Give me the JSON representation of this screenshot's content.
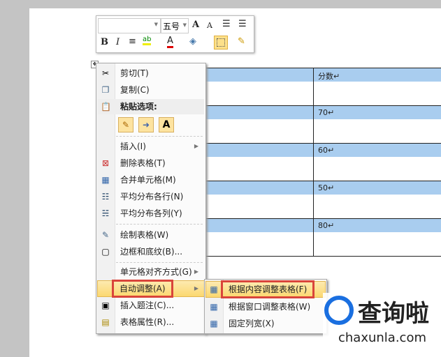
{
  "table": {
    "header": "分数↵",
    "values": [
      "70↵",
      "60↵",
      "50↵",
      "80↵"
    ]
  },
  "mini_toolbar": {
    "font_size": "五号",
    "grow": "A",
    "shrink": "A",
    "bold": "B",
    "italic": "I",
    "font_color": "A"
  },
  "context_menu": {
    "items": [
      {
        "label": "剪切(T)",
        "icon": "scissors-icon"
      },
      {
        "label": "复制(C)",
        "icon": "copy-icon"
      },
      {
        "label": "粘贴选项:",
        "icon": "paste-icon"
      },
      {
        "label": "插入(I)",
        "submenu": true
      },
      {
        "label": "删除表格(T)",
        "icon": "delete-table-icon"
      },
      {
        "label": "合并单元格(M)",
        "icon": "merge-cells-icon"
      },
      {
        "label": "平均分布各行(N)",
        "icon": "distribute-rows-icon"
      },
      {
        "label": "平均分布各列(Y)",
        "icon": "distribute-columns-icon"
      },
      {
        "label": "绘制表格(W)",
        "icon": "draw-table-icon"
      },
      {
        "label": "边框和底纹(B)...",
        "icon": "borders-icon"
      },
      {
        "label": "单元格对齐方式(G)",
        "submenu": true
      },
      {
        "label": "自动调整(A)",
        "submenu": true
      },
      {
        "label": "插入题注(C)...",
        "icon": "caption-icon"
      },
      {
        "label": "表格属性(R)...",
        "icon": "table-properties-icon"
      }
    ],
    "paste_keep_text": "A"
  },
  "submenu": {
    "items": [
      "根据内容调整表格(F)",
      "根据窗口调整表格(W)",
      "固定列宽(X)"
    ]
  },
  "watermark": {
    "name": "查询啦",
    "url": "chaxunla.com"
  }
}
